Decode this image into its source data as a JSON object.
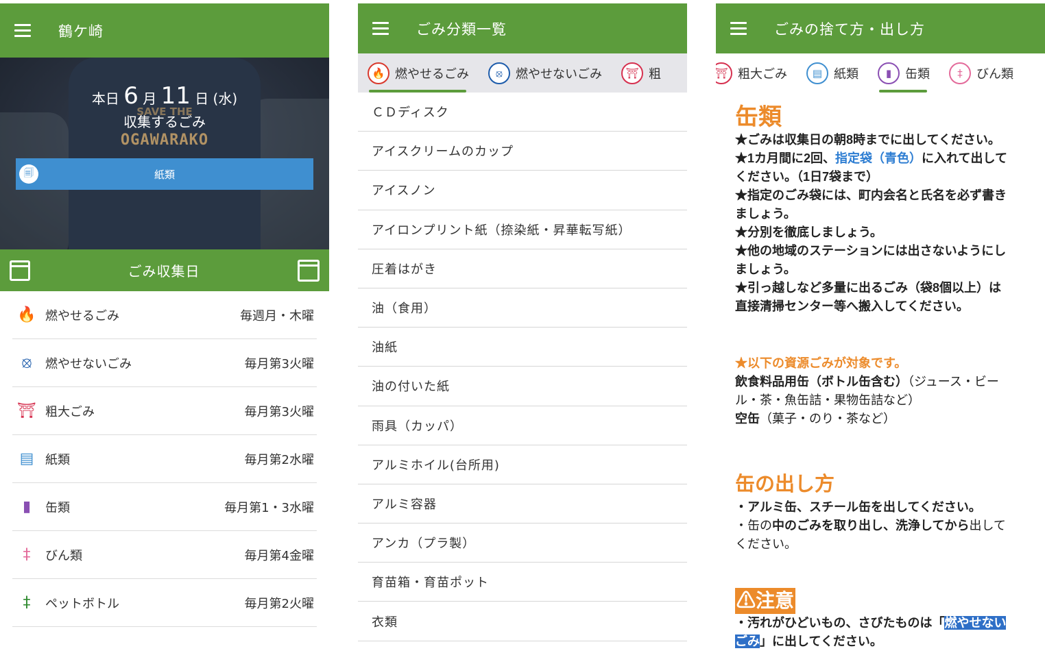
{
  "panel1": {
    "appbar_title": "鶴ケ崎",
    "hero": {
      "shirt_text_top": "SAVE THE",
      "shirt_text": "OGAWARAKO",
      "today_prefix": "本日",
      "month": "6",
      "month_suffix": "月",
      "day": "11",
      "day_suffix": "日",
      "weekday": "(水)",
      "subtitle": "収集するごみ",
      "chip_label": "紙類"
    },
    "calbar_title": "ごみ収集日",
    "schedule": [
      {
        "name": "燃やせるごみ",
        "day": "毎週月・木曜",
        "icon": "fire-icon"
      },
      {
        "name": "燃やせないごみ",
        "day": "毎月第3火曜",
        "icon": "no-burn-icon"
      },
      {
        "name": "粗大ごみ",
        "day": "毎月第3火曜",
        "icon": "furniture-icon"
      },
      {
        "name": "紙類",
        "day": "毎月第2水曜",
        "icon": "paper-icon"
      },
      {
        "name": "缶類",
        "day": "毎月第1・3水曜",
        "icon": "can-icon"
      },
      {
        "name": "びん類",
        "day": "毎月第4金曜",
        "icon": "bottle-icon"
      },
      {
        "name": "ペットボトル",
        "day": "毎月第2火曜",
        "icon": "pet-bottle-icon"
      }
    ]
  },
  "panel2": {
    "appbar_title": "ごみ分類一覧",
    "tabs": [
      "燃やせるごみ",
      "燃やせないごみ",
      "粗"
    ],
    "items": [
      "ＣＤディスク",
      "アイスクリームのカップ",
      "アイスノン",
      "アイロンプリント紙（捺染紙・昇華転写紙）",
      "圧着はがき",
      "油（食用）",
      "油紙",
      "油の付いた紙",
      "雨具（カッパ）",
      "アルミホイル(台所用)",
      "アルミ容器",
      "アンカ（プラ製）",
      "育苗箱・育苗ポット",
      "衣類"
    ]
  },
  "panel3": {
    "appbar_title": "ごみの捨て方・出し方",
    "tabs": [
      "粗大ごみ",
      "紙類",
      "缶類",
      "びん類"
    ],
    "title": "缶類",
    "rules": {
      "r1": "★ごみは収集日の朝8時までに出してください。",
      "r2a": "★1カ月間に2回、",
      "r2b": "指定袋（青色）",
      "r2c": "に入れて出して",
      "r2d": "ください。（1日7袋まで）",
      "r3a": "★指定のごみ袋には、町内会名と氏名を必ず書き",
      "r3b": "ましょう。",
      "r4": "★分別を徹底しましょう。",
      "r5a": "★他の地域のステーションには出さないようにし",
      "r5b": "ましょう。",
      "r6a": "★引っ越しなど多量に出るごみ（袋8個以上）は",
      "r6b": "直接清掃センター等へ搬入してください。"
    },
    "resources": {
      "head": "★以下の資源ごみが対象です。",
      "l1a": "飲食料品用缶（ボトル缶含む）",
      "l1b": "（ジュース・ビー",
      "l2": "ル・茶・魚缶詰・果物缶詰など）",
      "l3a": "空缶",
      "l3b": "（菓子・のり・茶など）"
    },
    "howto_title": "缶の出し方",
    "howto": {
      "h1": "・アルミ缶、スチール缶を出してください。",
      "h2a": "・缶の",
      "h2b": "中のごみを取り出し、洗浄してから",
      "h2c": "出して",
      "h3": "ください。"
    },
    "warning_title": "⚠注意",
    "warning": {
      "w1a": "・汚れがひどいもの、さびたものは「",
      "w1b": "燃やせない",
      "w2a": "ごみ",
      "w2b": "」に出してください。"
    }
  }
}
